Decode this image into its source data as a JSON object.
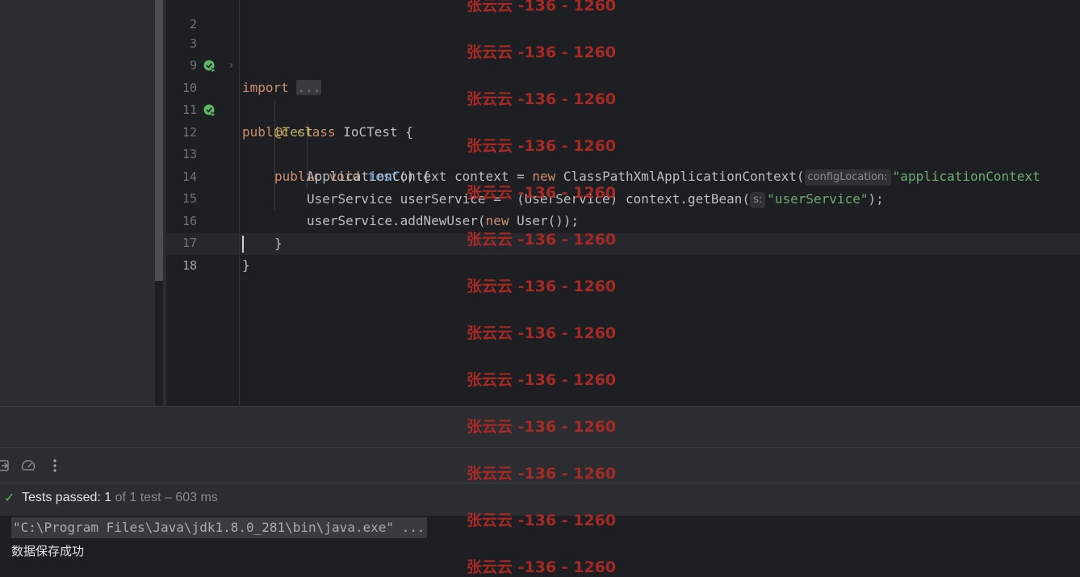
{
  "editor": {
    "lines": {
      "l2": {
        "num": "2"
      },
      "l3": {
        "num": "3",
        "kw": "import",
        "folded": "..."
      },
      "l9": {
        "num": "9"
      },
      "l10": {
        "num": "10",
        "kw1": "public",
        "kw2": "class",
        "rest": " IoCTest {"
      },
      "l11": {
        "num": "11",
        "annotation": "@Test"
      },
      "l12": {
        "num": "12",
        "kw1": "public",
        "kw2": "void",
        "method": "test",
        "rest": "() {"
      },
      "l13": {
        "num": "13",
        "pre": "ApplicationContext context = ",
        "kw": "new",
        "mid": " ClassPathXmlApplicationContext(",
        "hint": "configLocation:",
        "str": "\"applicationContext"
      },
      "l14": {
        "num": "14",
        "pre": "UserService userService =  (UserService) context.getBean(",
        "hint": "s:",
        "str": "\"userService\"",
        "post": ");"
      },
      "l15": {
        "num": "15",
        "pre": "userService.addNewUser(",
        "kw": "new",
        "post": " User());"
      },
      "l16": {
        "num": "16",
        "text": "}"
      },
      "l17": {
        "num": "17",
        "text": "}"
      },
      "l18": {
        "num": "18"
      }
    }
  },
  "run": {
    "status_check": "✓",
    "status_bold": "Tests passed: 1",
    "status_rest": " of 1 test – 603 ms",
    "command": "\"C:\\Program Files\\Java\\jdk1.8.0_281\\bin\\java.exe\" ...",
    "output": "数据保存成功"
  },
  "watermark": {
    "text": "张云云 -136 - 1260"
  },
  "icons": {
    "exit": "exit-icon",
    "speed": "speedometer-icon",
    "more": "more-vertical-icon",
    "run_test": "run-test-icon",
    "fold": "fold-arrow-icon"
  },
  "colors": {
    "background": "#1e1f22",
    "keyword": "#cf8e6d",
    "annotation": "#b3ae60",
    "method": "#56a8f5",
    "string": "#6aab73",
    "pass": "#5fb865",
    "watermark": "#b12a25"
  }
}
